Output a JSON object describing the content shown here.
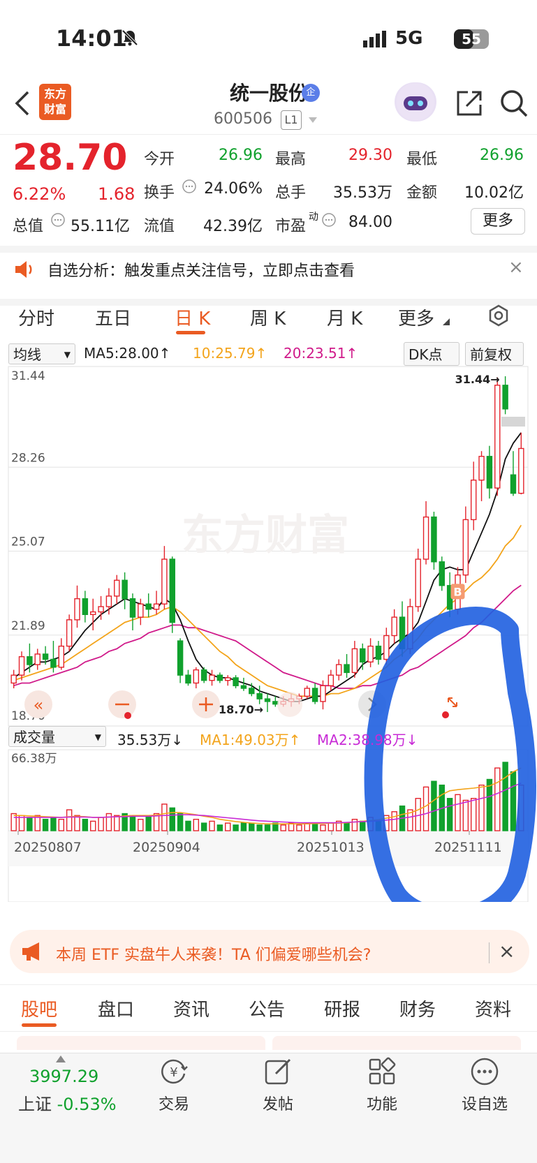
{
  "status": {
    "time": "14:01",
    "network": "5G",
    "battery": "55"
  },
  "header": {
    "logo_line1": "东方",
    "logo_line2": "财富",
    "stock_name": "统一股份",
    "badge": "企",
    "code": "600506",
    "level": "L1"
  },
  "quote": {
    "price": "28.70",
    "change_pct": "6.22%",
    "change": "1.68",
    "rows": [
      [
        {
          "label": "今开",
          "value": "26.96",
          "color": "green"
        },
        {
          "label": "最高",
          "value": "29.30",
          "color": "red"
        },
        {
          "label": "最低",
          "value": "26.96",
          "color": "green"
        }
      ],
      [
        {
          "label": "换手",
          "value": "24.06%",
          "color": "blk"
        },
        {
          "label": "总手",
          "value": "35.53万",
          "color": "blk"
        },
        {
          "label": "金额",
          "value": "10.02亿",
          "color": "blk"
        }
      ],
      [
        {
          "label": "总值",
          "value": "55.11亿",
          "color": "blk"
        },
        {
          "label": "流值",
          "value": "42.39亿",
          "color": "blk"
        },
        {
          "label": "市盈",
          "sup": "动",
          "value": "84.00",
          "color": "blk"
        }
      ]
    ],
    "more": "更多"
  },
  "notice": {
    "text": "自选分析：触发重点关注信号，立即点击查看",
    "close": "×"
  },
  "tabs": [
    "分时",
    "五日",
    "日 K",
    "周 K",
    "月 K",
    "更多"
  ],
  "active_tab": 2,
  "ma_bar": {
    "selector": "均线",
    "ma5": "MA5:28.00↑",
    "ma10": "10:25.79↑",
    "ma20": "20:23.51↑",
    "dk": "DK点",
    "fq": "前复权"
  },
  "vol_bar": {
    "selector": "成交量",
    "vol": "35.53万↓",
    "ma1": "MA1:49.03万↑",
    "ma2": "MA2:38.98万↓"
  },
  "chart_data": {
    "type": "candlestick",
    "price_axis_ticks": [
      "31.44",
      "28.26",
      "25.07",
      "21.89",
      "18.70"
    ],
    "ylim": [
      18.7,
      31.44
    ],
    "high_label": "31.44→",
    "low_label": "18.70→",
    "volume_axis_max": "66.38万",
    "date_ticks": [
      "20250807",
      "20250904",
      "20251013",
      "20251111"
    ],
    "signal_marker": "B",
    "watermark": "东方财富",
    "candles": [
      [
        19.8,
        20.3,
        19.6,
        20.1
      ],
      [
        20.1,
        21.0,
        19.9,
        20.8
      ],
      [
        20.8,
        21.3,
        20.2,
        20.5
      ],
      [
        20.5,
        21.1,
        20.3,
        20.9
      ],
      [
        20.9,
        21.2,
        20.5,
        20.7
      ],
      [
        20.7,
        21.4,
        20.2,
        20.4
      ],
      [
        20.4,
        21.5,
        20.3,
        21.2
      ],
      [
        21.2,
        22.4,
        21.0,
        22.2
      ],
      [
        22.2,
        23.5,
        21.9,
        23.0
      ],
      [
        23.0,
        23.3,
        22.1,
        22.4
      ],
      [
        22.4,
        23.0,
        21.8,
        22.5
      ],
      [
        22.5,
        23.1,
        22.2,
        22.7
      ],
      [
        22.7,
        23.4,
        22.4,
        23.1
      ],
      [
        23.1,
        23.9,
        22.8,
        23.7
      ],
      [
        23.7,
        24.0,
        22.6,
        23.0
      ],
      [
        23.0,
        23.2,
        21.8,
        22.3
      ],
      [
        22.3,
        23.0,
        22.0,
        22.8
      ],
      [
        22.8,
        23.2,
        22.3,
        22.6
      ],
      [
        22.6,
        23.3,
        22.4,
        22.8
      ],
      [
        22.8,
        25.0,
        22.6,
        24.5
      ],
      [
        24.5,
        24.6,
        21.7,
        22.1
      ],
      [
        21.4,
        21.5,
        19.8,
        20.1
      ],
      [
        20.1,
        20.3,
        19.7,
        19.8
      ],
      [
        19.8,
        20.4,
        19.6,
        20.3
      ],
      [
        20.3,
        20.4,
        19.8,
        19.9
      ],
      [
        19.9,
        20.3,
        19.7,
        20.1
      ],
      [
        20.1,
        20.2,
        19.8,
        19.9
      ],
      [
        19.9,
        20.1,
        19.7,
        20.0
      ],
      [
        20.0,
        20.1,
        19.6,
        19.7
      ],
      [
        19.7,
        20.0,
        19.5,
        19.6
      ],
      [
        19.6,
        19.8,
        19.3,
        19.4
      ],
      [
        19.4,
        19.7,
        19.0,
        19.2
      ],
      [
        19.2,
        19.4,
        18.7,
        19.1
      ],
      [
        19.1,
        19.3,
        18.9,
        19.0
      ],
      [
        19.0,
        19.3,
        18.9,
        19.1
      ],
      [
        19.1,
        19.4,
        18.9,
        19.2
      ],
      [
        19.2,
        19.4,
        19.0,
        19.3
      ],
      [
        19.3,
        19.7,
        19.2,
        19.6
      ],
      [
        19.6,
        19.8,
        19.0,
        19.1
      ],
      [
        19.1,
        19.9,
        18.8,
        19.7
      ],
      [
        19.7,
        20.3,
        19.5,
        20.1
      ],
      [
        20.1,
        20.7,
        19.9,
        20.5
      ],
      [
        20.5,
        20.9,
        20.0,
        20.2
      ],
      [
        20.2,
        21.4,
        20.0,
        21.1
      ],
      [
        21.1,
        21.3,
        20.3,
        20.6
      ],
      [
        20.6,
        21.5,
        20.4,
        21.2
      ],
      [
        21.2,
        21.4,
        20.5,
        20.7
      ],
      [
        20.7,
        21.9,
        20.5,
        21.6
      ],
      [
        21.6,
        22.6,
        21.3,
        22.3
      ],
      [
        22.3,
        22.9,
        20.8,
        21.1
      ],
      [
        21.1,
        23.0,
        20.9,
        22.7
      ],
      [
        22.7,
        24.9,
        22.5,
        24.5
      ],
      [
        24.5,
        26.7,
        24.3,
        26.1
      ],
      [
        26.1,
        26.3,
        24.1,
        24.4
      ],
      [
        24.4,
        24.6,
        23.3,
        23.5
      ],
      [
        23.5,
        24.0,
        22.3,
        22.6
      ],
      [
        22.6,
        24.2,
        22.4,
        23.9
      ],
      [
        23.9,
        26.5,
        23.6,
        26.0
      ],
      [
        26.0,
        28.2,
        25.6,
        27.5
      ],
      [
        27.5,
        28.6,
        26.7,
        28.4
      ],
      [
        28.4,
        28.8,
        26.8,
        27.2
      ],
      [
        27.2,
        31.4,
        26.9,
        31.1
      ],
      [
        31.1,
        31.44,
        30.0,
        30.2
      ],
      [
        27.7,
        28.6,
        26.9,
        27.0
      ],
      [
        27.0,
        29.3,
        26.96,
        28.7
      ]
    ],
    "ma5": [
      20.0,
      20.2,
      20.4,
      20.6,
      20.6,
      20.7,
      20.8,
      21.0,
      21.4,
      21.8,
      22.1,
      22.4,
      22.6,
      22.8,
      23.0,
      22.9,
      22.8,
      22.7,
      22.6,
      23.0,
      22.8,
      22.2,
      21.4,
      20.7,
      20.3,
      20.1,
      20.0,
      20.0,
      19.9,
      19.8,
      19.7,
      19.5,
      19.4,
      19.3,
      19.2,
      19.1,
      19.1,
      19.2,
      19.3,
      19.3,
      19.5,
      19.7,
      19.9,
      20.1,
      20.5,
      20.7,
      20.8,
      21.0,
      21.3,
      21.5,
      21.7,
      22.1,
      22.9,
      23.7,
      24.1,
      24.2,
      24.1,
      24.1,
      24.8,
      25.5,
      26.2,
      27.1,
      28.3,
      28.9,
      29.3
    ],
    "ma10": [
      19.9,
      20.0,
      20.1,
      20.2,
      20.3,
      20.4,
      20.5,
      20.7,
      20.9,
      21.1,
      21.3,
      21.5,
      21.7,
      21.9,
      22.1,
      22.2,
      22.3,
      22.3,
      22.4,
      22.6,
      22.7,
      22.5,
      22.2,
      21.9,
      21.6,
      21.3,
      21.0,
      20.8,
      20.5,
      20.3,
      20.1,
      19.9,
      19.7,
      19.6,
      19.5,
      19.4,
      19.3,
      19.3,
      19.3,
      19.3,
      19.4,
      19.4,
      19.5,
      19.6,
      19.8,
      20.0,
      20.2,
      20.4,
      20.7,
      20.9,
      21.2,
      21.5,
      21.9,
      22.2,
      22.5,
      22.8,
      23.0,
      23.3,
      23.6,
      23.8,
      24.1,
      24.5,
      25.0,
      25.3,
      25.79
    ],
    "ma20": [
      19.7,
      19.8,
      19.8,
      19.9,
      20.0,
      20.1,
      20.2,
      20.3,
      20.4,
      20.6,
      20.7,
      20.8,
      21.0,
      21.1,
      21.3,
      21.4,
      21.5,
      21.7,
      21.8,
      21.9,
      22.0,
      22.0,
      21.9,
      21.9,
      21.8,
      21.7,
      21.6,
      21.5,
      21.4,
      21.2,
      21.0,
      20.8,
      20.6,
      20.4,
      20.2,
      20.1,
      20.0,
      19.9,
      19.8,
      19.7,
      19.7,
      19.6,
      19.6,
      19.6,
      19.7,
      19.7,
      19.8,
      19.9,
      20.0,
      20.1,
      20.3,
      20.4,
      20.6,
      20.8,
      21.0,
      21.2,
      21.4,
      21.6,
      21.9,
      22.1,
      22.4,
      22.7,
      23.0,
      23.3,
      23.51
    ],
    "volume": [
      9,
      8,
      7,
      8,
      6,
      7,
      6,
      11,
      8,
      6,
      5,
      7,
      9,
      8,
      9,
      8,
      6,
      8,
      9,
      14,
      12,
      9,
      5,
      6,
      4,
      5,
      3,
      4,
      3,
      4,
      4,
      3,
      3,
      4,
      3,
      4,
      3,
      4,
      4,
      3,
      4,
      5,
      4,
      6,
      5,
      7,
      5,
      8,
      10,
      13,
      11,
      17,
      23,
      26,
      24,
      17,
      19,
      16,
      17,
      24,
      27,
      33,
      36,
      31,
      24
    ],
    "vol_ma1": [
      8,
      8,
      7.8,
      7.6,
      7.4,
      7.2,
      7,
      7.4,
      7.6,
      7.4,
      7,
      7,
      7.2,
      7.4,
      7.8,
      8,
      8,
      8,
      8.2,
      9,
      9.6,
      9.6,
      9,
      8.4,
      7.6,
      7,
      6,
      5.4,
      4.8,
      4.4,
      4,
      3.8,
      3.6,
      3.6,
      3.6,
      3.6,
      3.6,
      3.6,
      3.8,
      3.8,
      4,
      4,
      4.2,
      4.6,
      5,
      5.4,
      5.8,
      6.6,
      7.4,
      8.6,
      9.4,
      11,
      13,
      16,
      19,
      21,
      21.6,
      22,
      22.4,
      23,
      23.6,
      25.4,
      28,
      31,
      33
    ],
    "vol_ma2": [
      7,
      7,
      7,
      7,
      7,
      7,
      7,
      7.2,
      7.2,
      7.2,
      7,
      7,
      7.2,
      7.4,
      7.4,
      7.6,
      7.6,
      7.6,
      7.8,
      8,
      8.2,
      8.4,
      8.4,
      8.2,
      8,
      7.6,
      7.2,
      6.8,
      6.4,
      6,
      5.6,
      5.2,
      5,
      4.8,
      4.6,
      4.4,
      4.2,
      4.2,
      4.2,
      4.2,
      4.2,
      4.2,
      4.4,
      4.6,
      4.8,
      5,
      5.2,
      5.6,
      6,
      6.6,
      7.2,
      8,
      9,
      10.4,
      11.8,
      13,
      14,
      15,
      16,
      17,
      18,
      19.6,
      21.4,
      23.4,
      25
    ]
  },
  "ad": {
    "text": "本周 ETF 实盘牛人来袭！TA 们偏爱哪些机会?",
    "close": "×"
  },
  "bottom_tabs": [
    "股吧",
    "盘口",
    "资讯",
    "公告",
    "研报",
    "财务",
    "资料"
  ],
  "bottom_nav": {
    "index_value": "3997.29",
    "index_name": "上证",
    "index_pct": "-0.53%",
    "items": [
      "交易",
      "发帖",
      "功能",
      "设自选"
    ]
  },
  "colors": {
    "up": "#e4232c",
    "down": "#10a12d",
    "accent": "#ea5b23",
    "ma10": "#f3a41b",
    "ma20": "#d01a8a",
    "annotation": "#1f5fe0"
  }
}
